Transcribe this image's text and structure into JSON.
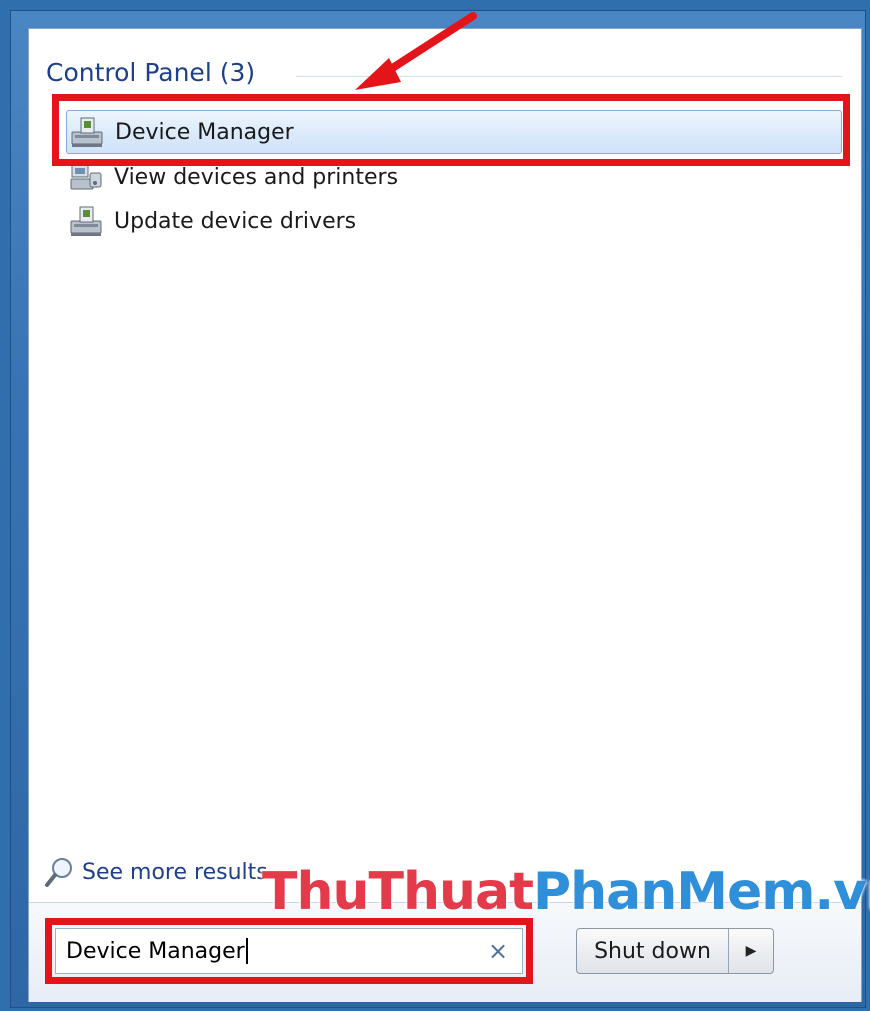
{
  "results": {
    "group_header": "Control Panel (3)",
    "items": [
      {
        "label": "Device Manager",
        "icon": "device-manager-icon",
        "selected": true
      },
      {
        "label": "View devices and printers",
        "icon": "devices-printers-icon",
        "selected": false
      },
      {
        "label": "Update device drivers",
        "icon": "device-manager-icon",
        "selected": false
      }
    ]
  },
  "see_more": {
    "label": "See more results",
    "icon": "magnifier-icon"
  },
  "search": {
    "value": "Device Manager",
    "clear_icon": "×"
  },
  "shutdown": {
    "label": "Shut down",
    "arrow": "▶"
  },
  "watermark": {
    "part1": "ThuThuat",
    "part2": "PhanMem.vn"
  },
  "colors": {
    "highlight": "#e4141b",
    "header_text": "#1e3f8a",
    "selection": "#dbeafb"
  }
}
